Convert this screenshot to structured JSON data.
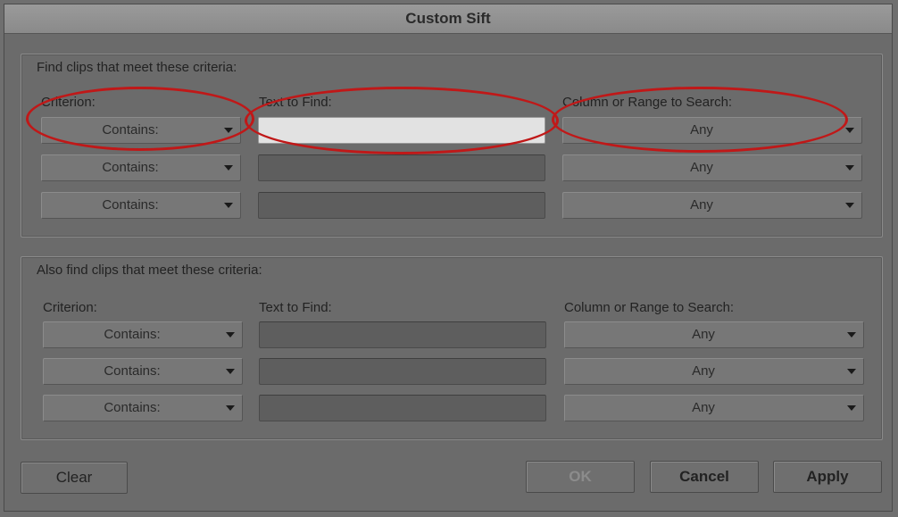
{
  "window": {
    "title": "Custom Sift"
  },
  "group1": {
    "title": "Find clips that meet these criteria:",
    "headers": {
      "criterion": "Criterion:",
      "text": "Text to Find:",
      "column": "Column or Range to Search:"
    },
    "rows": [
      {
        "criterion": "Contains:",
        "text": "",
        "column": "Any"
      },
      {
        "criterion": "Contains:",
        "text": "",
        "column": "Any"
      },
      {
        "criterion": "Contains:",
        "text": "",
        "column": "Any"
      }
    ]
  },
  "group2": {
    "title": "Also find clips that meet these criteria:",
    "headers": {
      "criterion": "Criterion:",
      "text": "Text to Find:",
      "column": "Column or Range to Search:"
    },
    "rows": [
      {
        "criterion": "Contains:",
        "text": "",
        "column": "Any"
      },
      {
        "criterion": "Contains:",
        "text": "",
        "column": "Any"
      },
      {
        "criterion": "Contains:",
        "text": "",
        "column": "Any"
      }
    ]
  },
  "buttons": {
    "clear": "Clear",
    "ok": "OK",
    "cancel": "Cancel",
    "apply": "Apply"
  },
  "colors": {
    "annotation": "#c01818",
    "active_field": "#e2e2e2"
  }
}
